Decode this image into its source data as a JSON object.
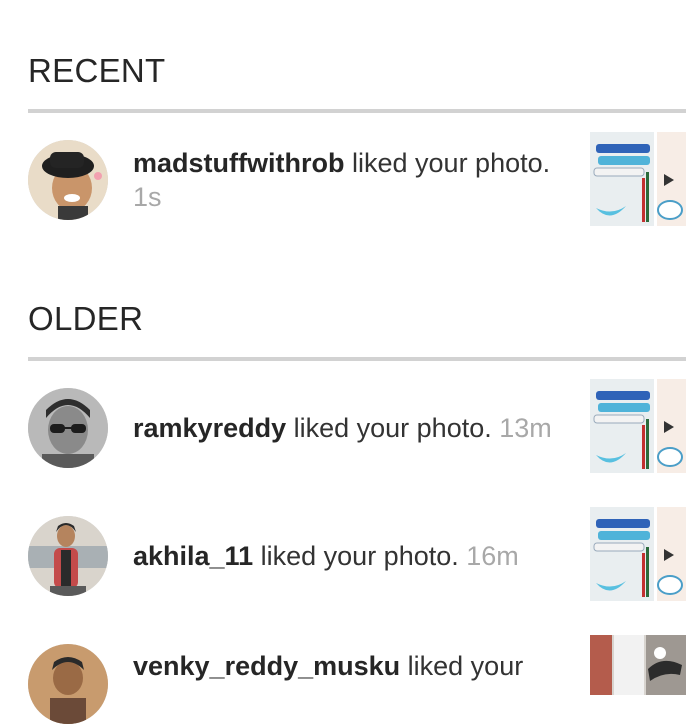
{
  "sections": {
    "recent_title": "RECENT",
    "older_title": "OLDER"
  },
  "notifications": [
    {
      "username": "madstuffwithrob",
      "action": "liked your photo.",
      "time": "1s",
      "avatar_icon": "user-avatar-hat",
      "thumbnail_icon": "craft-paints-photo"
    },
    {
      "username": "ramkyreddy",
      "action": "liked your photo.",
      "time": "13m",
      "avatar_icon": "user-avatar-sunglasses",
      "thumbnail_icon": "craft-paints-photo"
    },
    {
      "username": "akhila_11",
      "action": "liked your photo.",
      "time": "16m",
      "avatar_icon": "user-avatar-woman",
      "thumbnail_icon": "craft-paints-photo"
    },
    {
      "username": "venky_reddy_musku",
      "action": "liked your",
      "time": "",
      "avatar_icon": "user-avatar",
      "thumbnail_icon": "craft-photo"
    }
  ],
  "colors": {
    "text": "#262626",
    "muted": "#a8a8a8",
    "divider": "#d2d2d2"
  }
}
